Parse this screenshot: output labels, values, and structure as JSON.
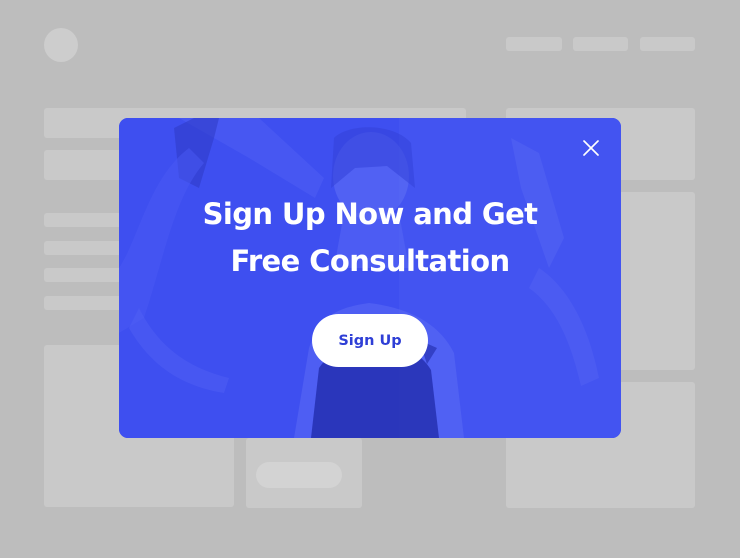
{
  "popup": {
    "title_line_1": "Sign Up Now and Get",
    "title_line_2": "Free Consultation",
    "cta_label": "Sign Up",
    "close_icon": "close-icon",
    "colors": {
      "overlay_blue": "#3e4ff0",
      "button_bg": "#ffffff",
      "button_text": "#2f3fd6",
      "page_dim": "#bdbdbd"
    }
  }
}
